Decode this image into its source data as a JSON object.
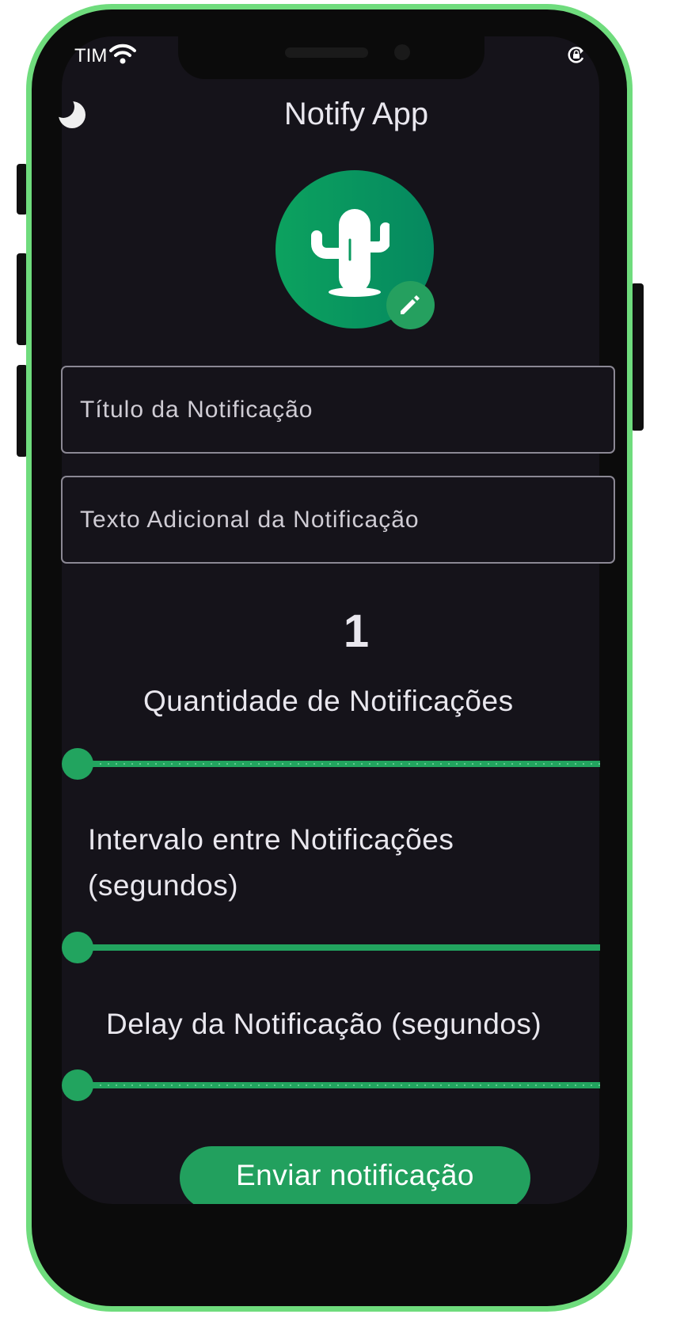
{
  "status_bar": {
    "carrier": "TIM",
    "icons": [
      "wifi-icon",
      "lock-rotate-icon"
    ]
  },
  "header": {
    "title": "Notify App",
    "theme_toggle_icon": "moon-icon"
  },
  "avatar": {
    "icon": "cactus-icon",
    "edit_icon": "pencil-icon",
    "colors": {
      "avatar": "#0ca25f",
      "edit_badge": "#25a05f"
    }
  },
  "form": {
    "title_placeholder": "Título da Notificação",
    "body_placeholder": "Texto Adicional da Notificação"
  },
  "quantity": {
    "value": "1",
    "label": "Quantidade de Notificações",
    "slider_fraction": 0
  },
  "interval": {
    "label_line1": "Intervalo entre Notificações",
    "label_line2": "(segundos)",
    "slider_fraction": 0
  },
  "delay": {
    "label": "Delay da Notificação (segundos)",
    "slider_fraction": 0
  },
  "actions": {
    "send_label": "Enviar notificação"
  },
  "theme": {
    "background": "#15131a",
    "accent": "#22a45f",
    "frame": "#6fdc7d"
  }
}
